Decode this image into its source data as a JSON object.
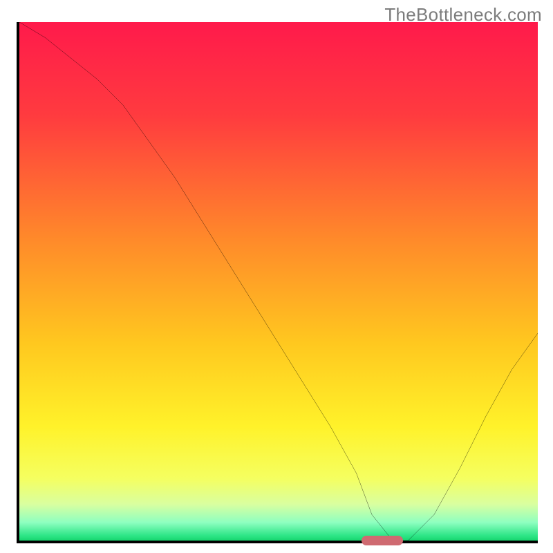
{
  "watermark": "TheBottleneck.com",
  "chart_data": {
    "type": "line",
    "title": "",
    "xlabel": "",
    "ylabel": "",
    "xlim": [
      0,
      100
    ],
    "ylim": [
      0,
      100
    ],
    "grid": false,
    "x": [
      0,
      5,
      10,
      15,
      20,
      25,
      30,
      35,
      40,
      45,
      50,
      55,
      60,
      65,
      68,
      72,
      75,
      80,
      85,
      90,
      95,
      100
    ],
    "values": [
      100,
      97,
      93,
      89,
      84,
      77,
      70,
      62,
      54,
      46,
      38,
      30,
      22,
      13,
      5,
      0,
      0,
      5,
      14,
      24,
      33,
      40
    ],
    "optimal_zone": {
      "x_start": 66,
      "x_end": 74,
      "y": 0
    },
    "background_gradient": {
      "stops": [
        {
          "pos": 0.0,
          "color": "#ff1a4b"
        },
        {
          "pos": 0.18,
          "color": "#ff3b3f"
        },
        {
          "pos": 0.42,
          "color": "#ff8a2a"
        },
        {
          "pos": 0.62,
          "color": "#ffc81f"
        },
        {
          "pos": 0.78,
          "color": "#fff22a"
        },
        {
          "pos": 0.88,
          "color": "#f5ff60"
        },
        {
          "pos": 0.93,
          "color": "#d9ffa0"
        },
        {
          "pos": 0.965,
          "color": "#8effc0"
        },
        {
          "pos": 0.99,
          "color": "#2fe688"
        },
        {
          "pos": 1.0,
          "color": "#17d66f"
        }
      ]
    }
  }
}
